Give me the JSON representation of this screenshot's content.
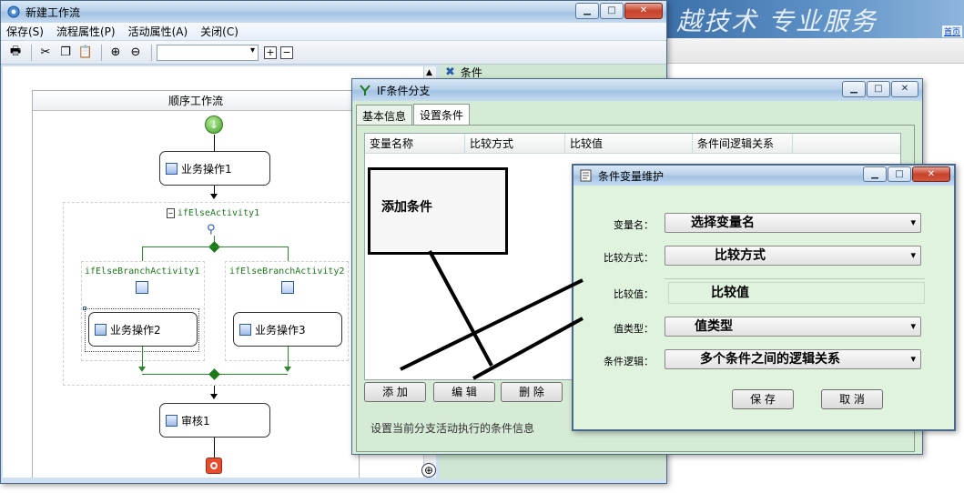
{
  "banner": {
    "slogan": "越技术 专业服务",
    "link": "首页"
  },
  "main_window": {
    "title": "新建工作流",
    "menu": [
      "保存(S)",
      "流程属性(P)",
      "活动属性(A)",
      "关闭(C)"
    ],
    "toolbar_icons": [
      "print-icon",
      "cut-icon",
      "copy-icon",
      "paste-icon",
      "zoom-in-icon",
      "zoom-out-icon"
    ],
    "workflow": {
      "header": "顺序工作流",
      "activity1": "业务操作1",
      "ifelse": "ifElseActivity1",
      "branch1": "ifElseBranchActivity1",
      "branch2": "ifElseBranchActivity2",
      "activity2": "业务操作2",
      "activity3": "业务操作3",
      "review": "审核1"
    },
    "right_pane": {
      "item1": "条件"
    }
  },
  "if_dialog": {
    "title": "IF条件分支",
    "tabs": [
      "基本信息",
      "设置条件"
    ],
    "columns": [
      "变量名称",
      "比较方式",
      "比较值",
      "条件间逻辑关系"
    ],
    "buttons": {
      "add": "添 加",
      "edit": "编 辑",
      "delete": "删 除"
    },
    "status": "设置当前分支活动执行的条件信息",
    "annotation": "添加条件"
  },
  "var_dialog": {
    "title": "条件变量维护",
    "rows": [
      {
        "label": "变量名：",
        "value": "选择变量名"
      },
      {
        "label": "比较方式：",
        "value": "比较方式"
      },
      {
        "label": "比较值：",
        "value": "比较值"
      },
      {
        "label": "值类型：",
        "value": "值类型"
      },
      {
        "label": "条件逻辑：",
        "value": "多个条件之间的逻辑关系"
      }
    ],
    "buttons": {
      "save": "保 存",
      "cancel": "取 消"
    }
  },
  "colors": {
    "accent_green": "#2b8a2b",
    "dialog_bg": "#d6ebd6",
    "title_blue": "#b9d1ea"
  }
}
